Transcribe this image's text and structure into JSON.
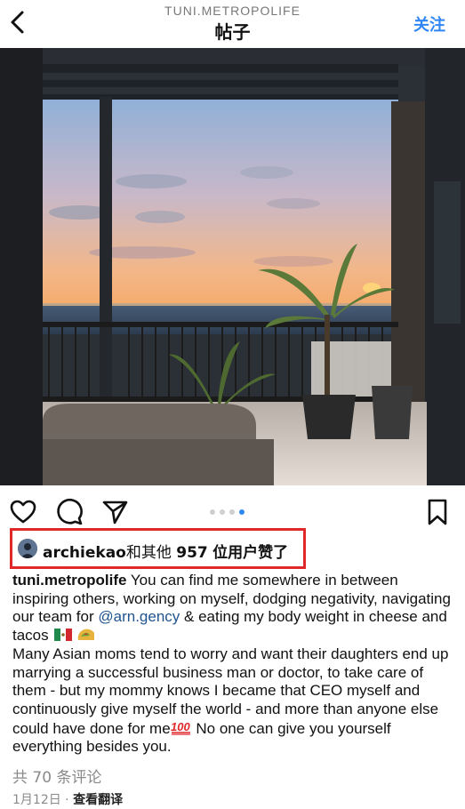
{
  "header": {
    "username": "TUNI.METROPOLIFE",
    "title": "帖子",
    "follow_label": "关注"
  },
  "carousel": {
    "count": 4,
    "active_index": 3
  },
  "likes": {
    "user": "archiekao",
    "mid": "和其他",
    "count": "957",
    "suffix": "位用户赞了"
  },
  "caption": {
    "username": "tuni.metropolife",
    "part1": " You can find me somewhere in between inspiring others, working on myself, dodging negativity, navigating our team for ",
    "mention": "@arn.gency",
    "part2": " & eating my body weight in cheese and tacos ",
    "para2": "Many Asian moms tend to worry and want their daughters end up marrying a successful business man or doctor, to take care of them - but my mommy knows I became that CEO myself and continuously give myself the world - and more than anyone else could have done for me",
    "para2_end": " No one can give you yourself everything besides you."
  },
  "comments_label": "共 70 条评论",
  "date": "1月12日",
  "separator": " · ",
  "translate_label": "查看翻译",
  "colors": {
    "accent": "#2f86f5",
    "highlight_box": "#e0282b",
    "mention": "#21548f"
  }
}
